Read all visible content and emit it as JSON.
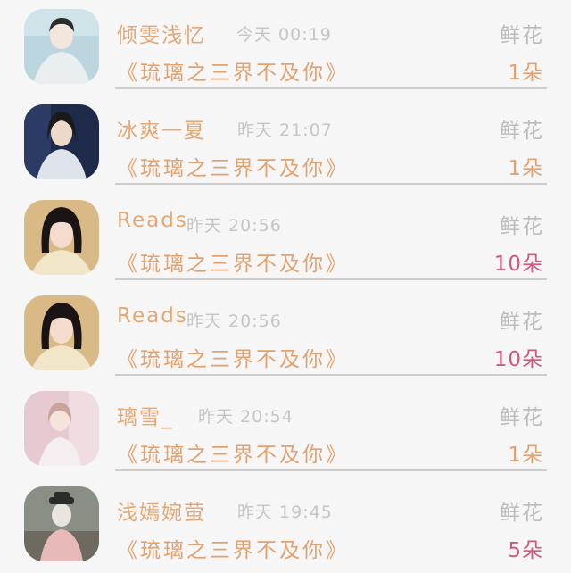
{
  "rows": [
    {
      "name": "倾雯浅忆",
      "time": "今天 00:19",
      "flower_label": "鲜花",
      "book": "《琉璃之三界不及你》",
      "count": "1朵",
      "count_color": "gold",
      "avatar_palette": [
        "#bcd6df",
        "#e9eef0",
        "#2b2b2b",
        "#f2e6dd"
      ]
    },
    {
      "name": "冰爽一夏",
      "time": "昨天 21:07",
      "flower_label": "鲜花",
      "book": "《琉璃之三界不及你》",
      "count": "1朵",
      "count_color": "gold",
      "avatar_palette": [
        "#1e2a4a",
        "#dfe3ea",
        "#1a1a1a",
        "#eed9c9"
      ]
    },
    {
      "name": "Reads",
      "time": "昨天 20:56",
      "flower_label": "鲜花",
      "book": "《琉璃之三界不及你》",
      "count": "10朵",
      "count_color": "pink",
      "avatar_palette": [
        "#d9b985",
        "#f1e7c8",
        "#1b1414",
        "#f3dccd"
      ]
    },
    {
      "name": "Reads",
      "time": "昨天 20:56",
      "flower_label": "鲜花",
      "book": "《琉璃之三界不及你》",
      "count": "10朵",
      "count_color": "pink",
      "avatar_palette": [
        "#d9b985",
        "#f1e7c8",
        "#1b1414",
        "#f3dccd"
      ]
    },
    {
      "name": "璃雪_",
      "time": "昨天 20:54",
      "flower_label": "鲜花",
      "book": "《琉璃之三界不及你》",
      "count": "1朵",
      "count_color": "gold",
      "avatar_palette": [
        "#e6c9d1",
        "#f4eef0",
        "#caa39a",
        "#f6e3dc"
      ]
    },
    {
      "name": "浅嫣婉萤",
      "time": "昨天 19:45",
      "flower_label": "鲜花",
      "book": "《琉璃之三界不及你》",
      "count": "5朵",
      "count_color": "pink",
      "avatar_palette": [
        "#8a8f86",
        "#e9e4e0",
        "#2b2b2b",
        "#e8b9b9"
      ]
    }
  ]
}
